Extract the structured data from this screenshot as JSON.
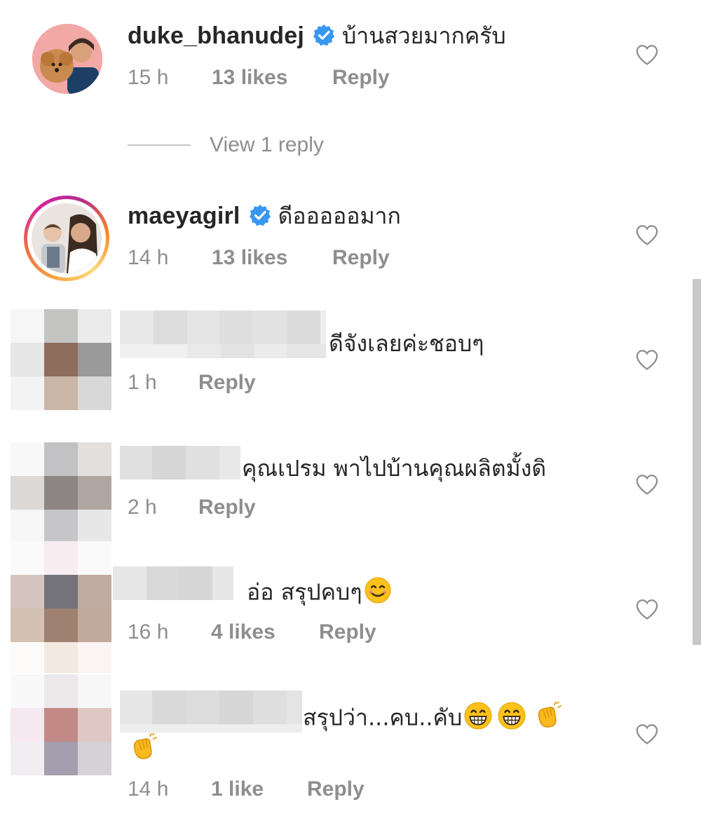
{
  "comments": [
    {
      "username": "duke_bhanudej",
      "verified": true,
      "text": "บ้านสวยมากครับ",
      "time": "15 h",
      "likes": "13 likes",
      "reply": "Reply",
      "avatar_icon": "profile-photo-man-with-dog"
    },
    {
      "view_replies": "View 1 reply"
    },
    {
      "username": "maeyagirl",
      "verified": true,
      "text": "ดีอออออมาก",
      "time": "14 h",
      "likes": "13 likes",
      "reply": "Reply",
      "avatar_icon": "profile-photo-woman-with-child",
      "story_ring": true
    },
    {
      "username_hidden": true,
      "text": "ดีจังเลยค่ะชอบๆ",
      "time": "1 h",
      "reply": "Reply"
    },
    {
      "username_hidden": true,
      "text": "คุณเปรม พาไปบ้านคุณผลิตมั้งดิ",
      "time": "2 h",
      "reply": "Reply"
    },
    {
      "username_hidden": true,
      "text": "อ่อ สรุปคบๆ",
      "emoji": [
        "smiling-face-emoji"
      ],
      "time": "16 h",
      "likes": "4 likes",
      "reply": "Reply"
    },
    {
      "username_hidden": true,
      "text": "สรุปว่า...คบ..คับ",
      "emoji": [
        "grinning-face-emoji",
        "grinning-face-emoji",
        "clapping-hands-emoji",
        "clapping-hands-emoji"
      ],
      "time": "14 h",
      "likes": "1 like",
      "reply": "Reply"
    }
  ],
  "colors": {
    "text_primary": "#262626",
    "text_secondary": "#8e8e8e",
    "verified_badge": "#3897f0",
    "heart_outline": "#8e8e8e"
  }
}
